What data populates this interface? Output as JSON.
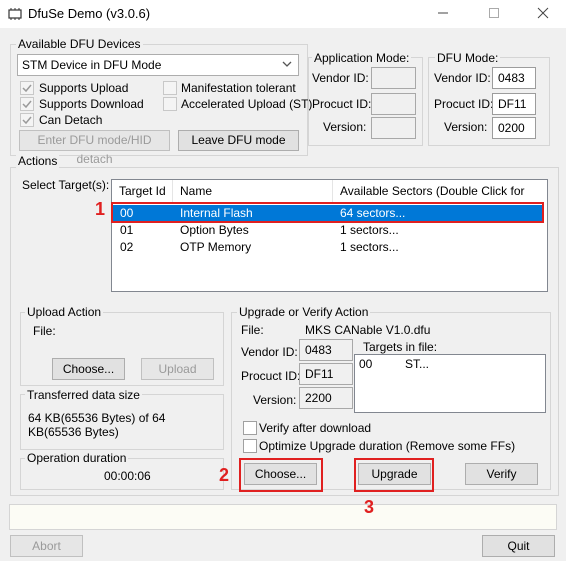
{
  "window": {
    "title": "DfuSe Demo (v3.0.6)",
    "min_icon": "minimize-icon",
    "max_icon": "maximize-icon",
    "close_icon": "close-icon"
  },
  "dfu_devices": {
    "legend": "Available DFU Devices",
    "selected": "STM Device in DFU Mode",
    "checks": {
      "supports_upload": "Supports Upload",
      "supports_download": "Supports Download",
      "can_detach": "Can Detach",
      "manifestation_tolerant": "Manifestation tolerant",
      "accelerated_upload": "Accelerated Upload (ST)"
    },
    "enter_dfu_button": "Enter DFU mode/HID detach",
    "leave_dfu_button": "Leave DFU mode"
  },
  "app_mode": {
    "legend": "Application Mode:",
    "vendor_label": "Vendor ID:",
    "product_label": "Procuct ID:",
    "version_label": "Version:"
  },
  "dfu_mode": {
    "legend": "DFU Mode:",
    "vendor_label": "Vendor ID:",
    "vendor": "0483",
    "product_label": "Procuct ID:",
    "product": "DF11",
    "version_label": "Version:",
    "version": "0200"
  },
  "actions": {
    "legend": "Actions",
    "select_target_label": "Select Target(s):",
    "columns": [
      "Target Id",
      "Name",
      "Available Sectors (Double Click for more)"
    ],
    "rows": [
      {
        "id": "00",
        "name": "Internal Flash",
        "sectors": "64 sectors..."
      },
      {
        "id": "01",
        "name": "Option Bytes",
        "sectors": "1 sectors..."
      },
      {
        "id": "02",
        "name": "OTP Memory",
        "sectors": "1 sectors..."
      }
    ]
  },
  "upload_action": {
    "legend": "Upload Action",
    "file_label": "File:",
    "choose_button": "Choose...",
    "upload_button": "Upload"
  },
  "transferred": {
    "legend": "Transferred data size",
    "text": "64 KB(65536 Bytes) of 64 KB(65536 Bytes)"
  },
  "duration": {
    "legend": "Operation duration",
    "value": "00:00:06"
  },
  "upgrade": {
    "legend": "Upgrade or Verify Action",
    "file_label": "File:",
    "file_value": "MKS CANable V1.0.dfu",
    "vendor_label": "Vendor ID:",
    "vendor": "0483",
    "product_label": "Procuct ID:",
    "product": "DF11",
    "version_label": "Version:",
    "version": "2200",
    "targets_label": "Targets in file:",
    "target_id": "00",
    "target_name": "ST...",
    "verify_after_download": "Verify after download",
    "optimize_upgrade": "Optimize Upgrade duration (Remove some FFs)",
    "choose_button": "Choose...",
    "upgrade_button": "Upgrade",
    "verify_button": "Verify"
  },
  "bottom": {
    "abort_button": "Abort",
    "quit_button": "Quit"
  },
  "annotations": {
    "num1": "1",
    "num2": "2",
    "num3": "3",
    "color": "#e02020"
  }
}
